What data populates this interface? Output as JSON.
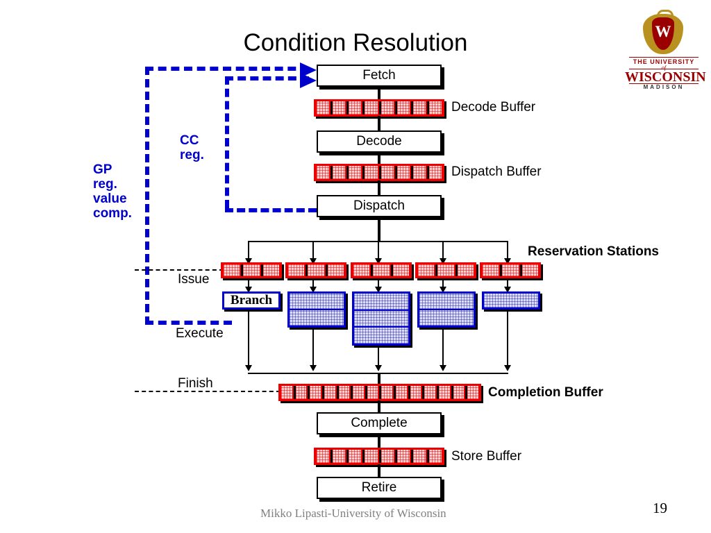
{
  "slide": {
    "title": "Condition Resolution",
    "footer": "Mikko Lipasti-University of Wisconsin",
    "page_number": "19"
  },
  "logo": {
    "crest_letter": "W",
    "line1": "THE UNIVERSITY",
    "line2": "of",
    "line3": "WISCONSIN",
    "line4": "MADISON"
  },
  "stages": {
    "fetch": "Fetch",
    "decode": "Decode",
    "dispatch": "Dispatch",
    "complete": "Complete",
    "retire": "Retire"
  },
  "buffers": {
    "decode_buffer": "Decode Buffer",
    "dispatch_buffer": "Dispatch Buffer",
    "completion_buffer": "Completion Buffer",
    "store_buffer": "Store Buffer",
    "reservation_stations": "Reservation\nStations",
    "decode_cells": 8,
    "dispatch_cells": 8,
    "completion_cells": 14,
    "store_cells": 8
  },
  "stage_labels": {
    "issue": "Issue",
    "execute": "Execute",
    "finish": "Finish"
  },
  "annotations": {
    "gp_reg": "GP\nreg.\nvalue\ncomp.",
    "cc_reg": "CC\nreg."
  },
  "functional_units": {
    "branch_label": "Branch",
    "unit_rows": [
      1,
      2,
      3,
      2,
      1
    ]
  },
  "colors": {
    "buffer_border": "#ee0000",
    "buffer_fill": "#fbd5d5",
    "fu_border": "#0000cc",
    "fu_fill": "#dcdcf2",
    "annotation_blue": "#0000cc",
    "stage_border": "#000000",
    "logo_crimson": "#9b0000",
    "logo_gold": "#b8911f",
    "footer_gray": "#808080"
  }
}
